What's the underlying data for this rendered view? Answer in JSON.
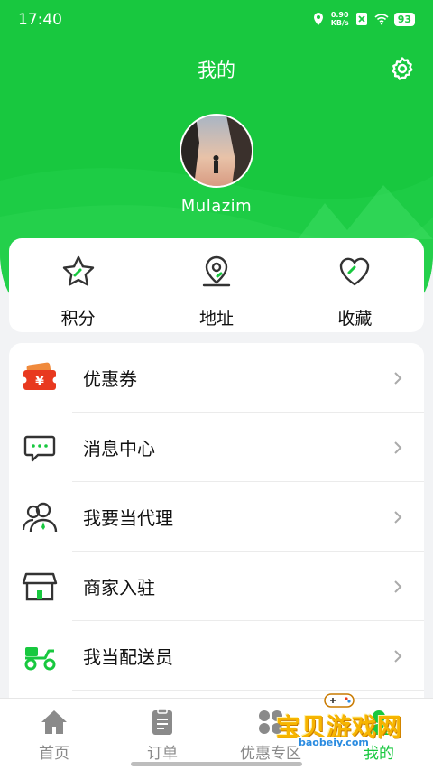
{
  "status_bar": {
    "time": "17:40",
    "speed_value": "0.90",
    "speed_unit": "KB/s",
    "battery": "93"
  },
  "header": {
    "title": "我的",
    "settings_icon": "gear-icon"
  },
  "profile": {
    "username": "Mulazim"
  },
  "quick_actions": [
    {
      "label": "积分",
      "icon": "star-icon"
    },
    {
      "label": "地址",
      "icon": "location-pin-icon"
    },
    {
      "label": "收藏",
      "icon": "heart-icon"
    }
  ],
  "menu": [
    {
      "label": "优惠券",
      "icon": "coupon-icon"
    },
    {
      "label": "消息中心",
      "icon": "message-icon"
    },
    {
      "label": "我要当代理",
      "icon": "agent-icon"
    },
    {
      "label": "商家入驻",
      "icon": "store-icon"
    },
    {
      "label": "我当配送员",
      "icon": "delivery-scooter-icon"
    }
  ],
  "tabbar": [
    {
      "label": "首页",
      "icon": "home-icon",
      "active": false
    },
    {
      "label": "订单",
      "icon": "order-icon",
      "active": false
    },
    {
      "label": "优惠专区",
      "icon": "discount-icon",
      "active": false
    },
    {
      "label": "我的",
      "icon": "profile-icon",
      "active": true
    }
  ],
  "watermark": {
    "text": "宝贝游戏网",
    "url_text": "baobeiy.com"
  },
  "colors": {
    "brand_green": "#18c83f",
    "coupon_red": "#e8391f",
    "accent_orange": "#f7b500"
  }
}
